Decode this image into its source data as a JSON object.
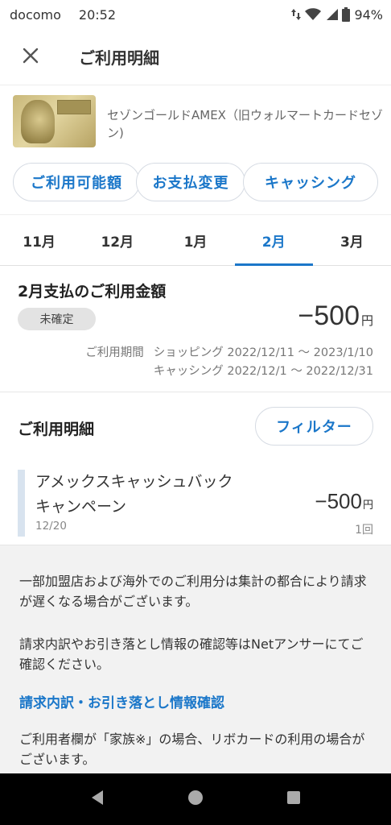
{
  "status_bar": {
    "carrier": "docomo",
    "time": "20:52",
    "battery": "94%"
  },
  "app_bar": {
    "title": "ご利用明細",
    "close_icon": "close-icon"
  },
  "card": {
    "name": "セゾンゴールドAMEX（旧ウォルマートカードセゾン)",
    "brand_text": "AMERICAN EXPRESS"
  },
  "chips": [
    {
      "label": "ご利用可能額"
    },
    {
      "label": "お支払変更"
    },
    {
      "label": "キャッシング"
    }
  ],
  "months": {
    "active_index": 3,
    "items": [
      {
        "label": "11月"
      },
      {
        "label": "12月"
      },
      {
        "label": "1月"
      },
      {
        "label": "2月"
      },
      {
        "label": "3月"
      }
    ]
  },
  "summary": {
    "title": "2月支払のご利用金額",
    "status": "未確定",
    "amount": "−500",
    "currency": "円",
    "period_label": "ご利用期間",
    "shopping": "ショッピング 2022/12/11 〜 2023/1/10",
    "cashing": "キャッシング 2022/12/1 〜 2022/12/31"
  },
  "details": {
    "title": "ご利用明細",
    "filter_label": "フィルター",
    "transactions": [
      {
        "name": "アメックスキャッシュバックキャンペーン",
        "date": "12/20",
        "amount": "−500",
        "currency": "円",
        "count": "1回"
      }
    ]
  },
  "notice": {
    "p1": "一部加盟店および海外でのご利用分は集計の都合により請求が遅くなる場合がございます。",
    "p2": " 請求内訳やお引き落とし情報の確認等はNetアンサーにてご確認ください。",
    "link": "請求内訳・お引き落とし情報確認",
    "p3": "ご利用者欄が「家族※」の場合、リボカードの利用の場合がございます。"
  },
  "colors": {
    "accent": "#1b77c9",
    "pill_bg": "#e3e3e3",
    "notice_bg": "#f2f2f2",
    "nav_bg": "#000000"
  }
}
